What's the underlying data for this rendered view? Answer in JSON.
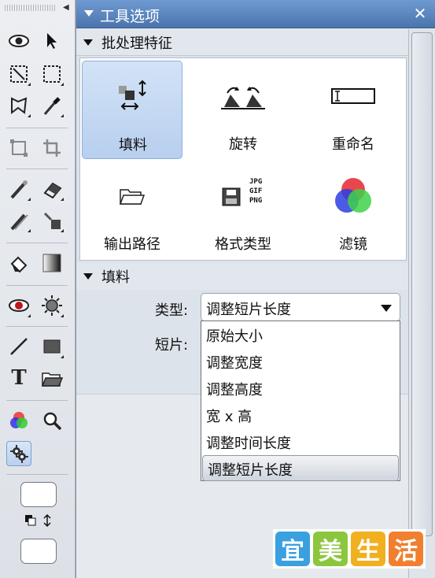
{
  "panel": {
    "title": "工具选项",
    "close": "✕"
  },
  "batch": {
    "header": "批处理特征",
    "items": [
      {
        "label": "填料",
        "selected": true,
        "icon": "fill-icon"
      },
      {
        "label": "旋转",
        "selected": false,
        "icon": "rotate-icon"
      },
      {
        "label": "重命名",
        "selected": false,
        "icon": "rename-icon"
      },
      {
        "label": "输出路径",
        "selected": false,
        "icon": "folder-icon"
      },
      {
        "label": "格式类型",
        "selected": false,
        "icon": "format-icon",
        "formats": [
          "JPG",
          "GIF",
          "PNG"
        ]
      },
      {
        "label": "滤镜",
        "selected": false,
        "icon": "filter-icon"
      }
    ]
  },
  "fill": {
    "header": "填料",
    "type_label": "类型:",
    "type_value": "调整短片长度",
    "clip_label": "短片:",
    "options": [
      "原始大小",
      "调整宽度",
      "调整高度",
      "宽 x 高",
      "调整时间长度",
      "调整短片长度"
    ],
    "selected_option": "调整短片长度"
  },
  "toolbox": {
    "text_tool": "T",
    "tools": [
      "eye-icon",
      "arrow-select-icon",
      "transform-select-icon",
      "marquee-icon",
      "lasso-icon",
      "eyedropper-icon",
      "distort-icon",
      "crop-icon",
      "brush-icon",
      "eraser-icon",
      "clone-brush-icon",
      "bucket-brush-icon",
      "paint-bucket-icon",
      "gradient-icon",
      "red-eye-icon",
      "brightness-icon",
      "line-icon",
      "rectangle-icon",
      "text-icon",
      "open-folder-icon",
      "color-wheel-icon",
      "zoom-icon",
      "batch-gear-icon"
    ]
  },
  "watermark": {
    "chars": [
      "宜",
      "美",
      "生",
      "活"
    ],
    "colors": [
      "#3aa0e0",
      "#8cc63e",
      "#f0b020",
      "#f08030"
    ]
  }
}
